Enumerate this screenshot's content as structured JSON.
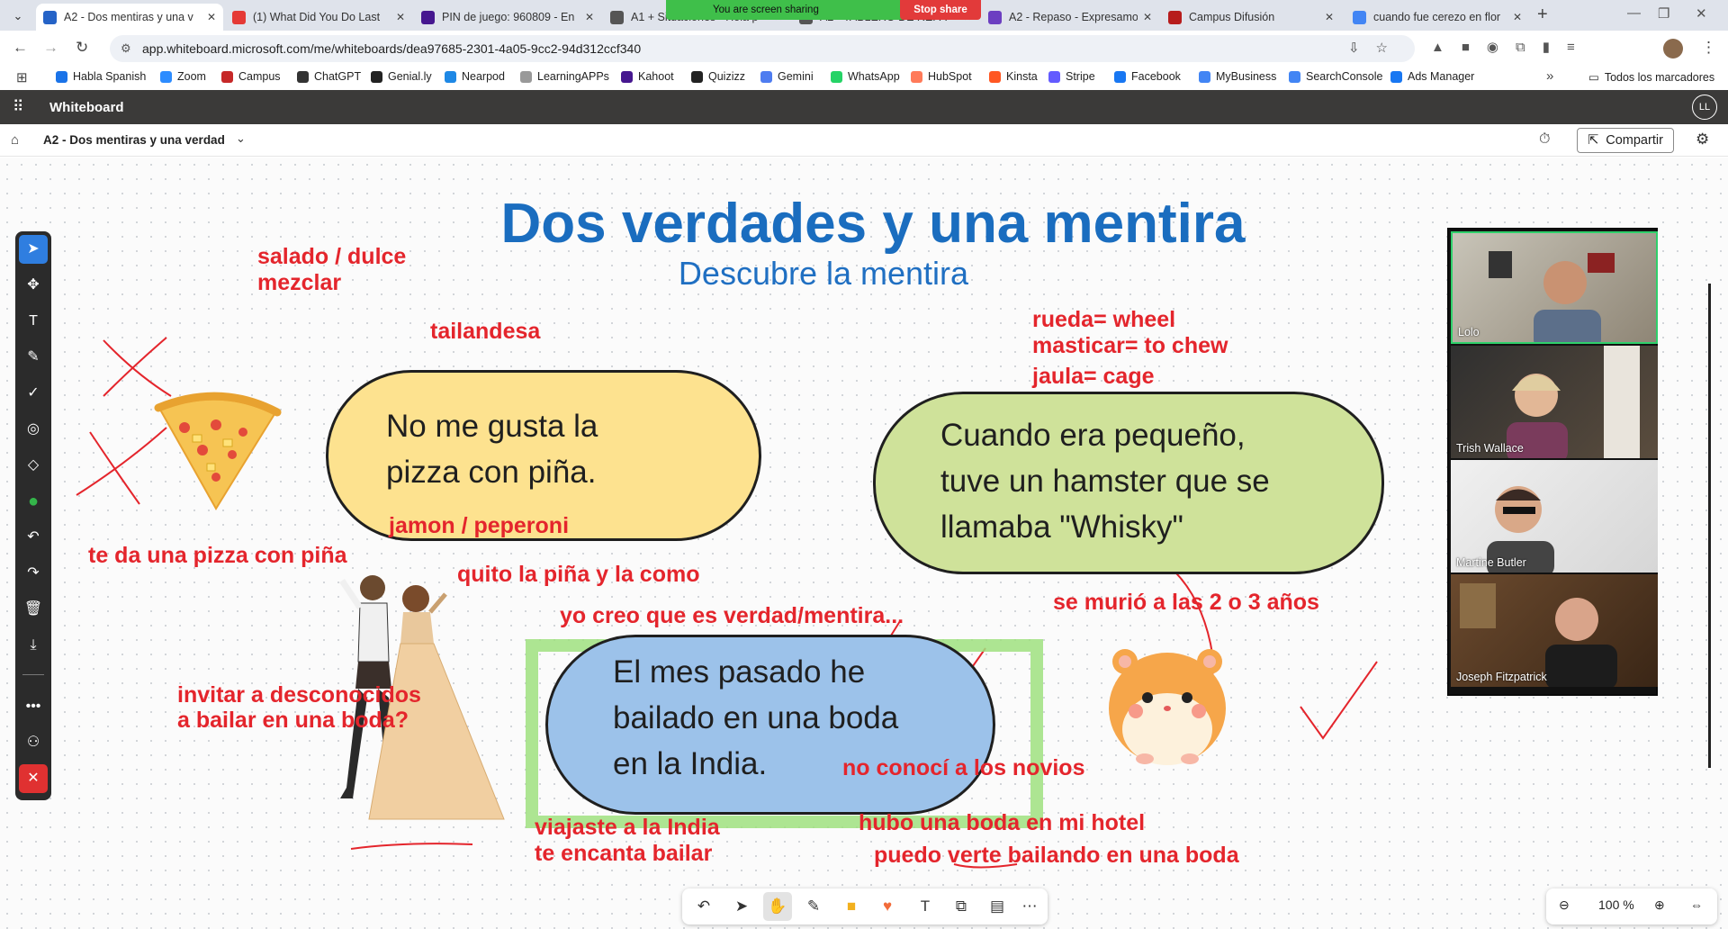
{
  "browser": {
    "tabs": [
      {
        "label": "A2 - Dos mentiras y una v",
        "active": true,
        "favicon_color": "#2563c7"
      },
      {
        "label": "(1) What Did You Do Last",
        "active": false,
        "favicon_color": "#e53935"
      },
      {
        "label": "PIN de juego: 960809 - En",
        "active": false,
        "favicon_color": "#46178f"
      },
      {
        "label": "A1 + Situaciones - Hola p",
        "active": false,
        "favicon_color": "#555555"
      },
      {
        "label": "A2 - TABLERO DE REPA",
        "active": false,
        "favicon_color": "#555555"
      },
      {
        "label": "A2 - Repaso - Expresamo",
        "active": false,
        "favicon_color": "#6c3fc1"
      },
      {
        "label": "Campus Difusión",
        "active": false,
        "favicon_color": "#b71c1c"
      },
      {
        "label": "cuando fue cerezo en flor",
        "active": false,
        "favicon_color": "#4285f4"
      }
    ],
    "screen_share": {
      "status": "You are screen sharing",
      "stop_label": "Stop share"
    },
    "url": "app.whiteboard.microsoft.com/me/whiteboards/dea97685-2301-4a05-9cc2-94d312ccf340",
    "bookmarks": [
      {
        "label": "Habla Spanish",
        "color": "#1a73e8"
      },
      {
        "label": "Zoom",
        "color": "#2d8cff"
      },
      {
        "label": "Campus",
        "color": "#c62828"
      },
      {
        "label": "ChatGPT",
        "color": "#333333"
      },
      {
        "label": "Genial.ly",
        "color": "#222222"
      },
      {
        "label": "Nearpod",
        "color": "#1e88e5"
      },
      {
        "label": "LearningAPPs",
        "color": "#999999"
      },
      {
        "label": "Kahoot",
        "color": "#46178f"
      },
      {
        "label": "Quizizz",
        "color": "#222222"
      },
      {
        "label": "Gemini",
        "color": "#4e7cf0"
      },
      {
        "label": "WhatsApp",
        "color": "#25d366"
      },
      {
        "label": "HubSpot",
        "color": "#ff7a59"
      },
      {
        "label": "Kinsta",
        "color": "#ff5722"
      },
      {
        "label": "Stripe",
        "color": "#635bff"
      },
      {
        "label": "Facebook",
        "color": "#1877f2"
      },
      {
        "label": "MyBusiness",
        "color": "#4285f4"
      },
      {
        "label": "SearchConsole",
        "color": "#4285f4"
      },
      {
        "label": "Ads Manager",
        "color": "#1877f2"
      }
    ],
    "all_bookmarks": "Todos los marcadores"
  },
  "app": {
    "name": "Whiteboard",
    "user_initials": "LL",
    "board_name": "A2 - Dos mentiras y una verdad",
    "share_label": "Compartir"
  },
  "board": {
    "title": "Dos verdades y una mentira",
    "subtitle": "Descubre la mentira",
    "statement1_line1": "No me gusta la",
    "statement1_line2": "pizza con piña.",
    "statement2_line1": "Cuando era pequeño,",
    "statement2_line2": "tuve un hamster que se",
    "statement2_line3": "llamaba \"Whisky\"",
    "statement3_line1": "El mes pasado he",
    "statement3_line2": "bailado en una boda",
    "statement3_line3": "en la India.",
    "annotations": {
      "salado": "salado / dulce",
      "mezclar": "mezclar",
      "tailandesa": "tailandesa",
      "jamon": "jamon / peperoni",
      "te_da": "te da una pizza con piña",
      "quito": "quito la piña y la como",
      "yo_creo": "yo creo que es verdad/mentira...",
      "rueda": "rueda= wheel",
      "masticar": "masticar= to chew",
      "jaula": "jaula= cage",
      "murio": "se murió a las 2 o 3 años",
      "invitar1": "invitar a desconocidos",
      "invitar2": "a bailar  en una boda?",
      "no_conoci": "no conocí a los novios",
      "viajaste": "viajaste a la India",
      "encanta": "te encanta bailar",
      "hubo": "hubo una boda en mi hotel",
      "puedo": "puedo verte bailando en una boda"
    }
  },
  "participants": [
    {
      "name": "Lolo",
      "speaking": true
    },
    {
      "name": "Trish Wallace",
      "speaking": false
    },
    {
      "name": "Martine Butler",
      "speaking": false
    },
    {
      "name": "Joseph Fitzpatrick",
      "speaking": false
    }
  ],
  "zoom": {
    "level": "100 %"
  },
  "colors": {
    "accent": "#2f7ee0",
    "annotation": "#e4252c",
    "title": "#1a6dbf"
  }
}
